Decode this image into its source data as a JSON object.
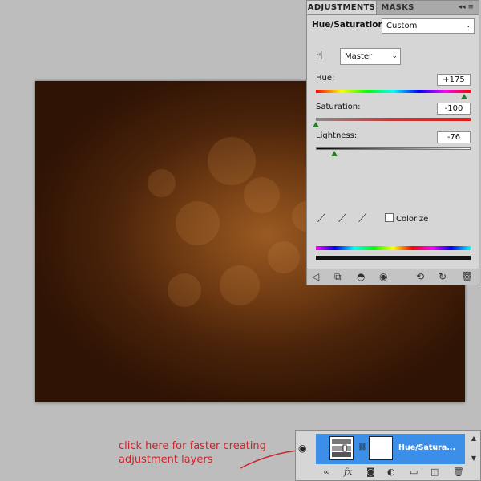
{
  "adjustments": {
    "tabs": [
      {
        "label": "ADJUSTMENTS"
      },
      {
        "label": "MASKS"
      }
    ],
    "panel_controls": "◂◂ ≡",
    "title": "Hue/Saturation",
    "preset_value": "Custom",
    "channel_value": "Master",
    "hue": {
      "label": "Hue:",
      "value": "+175"
    },
    "saturation": {
      "label": "Saturation:",
      "value": "-100"
    },
    "lightness": {
      "label": "Lightness:",
      "value": "-76"
    },
    "colorize_label": "Colorize"
  },
  "layers": {
    "layer_name": "Hue/Satura..."
  },
  "annotation": {
    "line1": "click here for faster creating",
    "line2": "adjustment layers"
  },
  "colors": {
    "accent_blue": "#3b8fe8",
    "annotation_red": "#d0222a",
    "slider_thumb": "#2b7a2b"
  }
}
